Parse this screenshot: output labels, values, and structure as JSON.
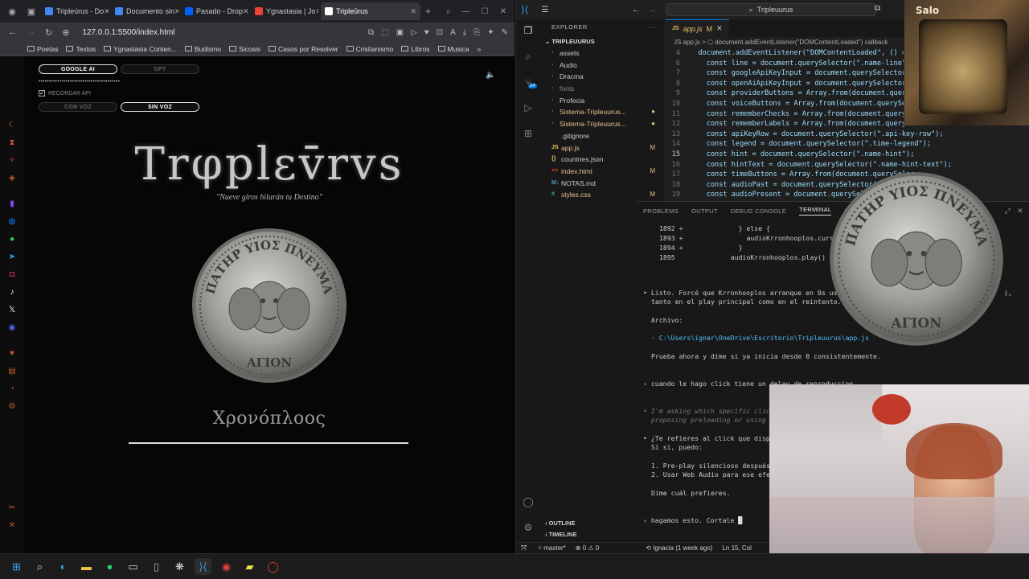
{
  "browser": {
    "tabs": [
      {
        "label": "Tripleúrus - Do",
        "color": "#4285f4",
        "active": false
      },
      {
        "label": "Documento sin",
        "color": "#4285f4",
        "active": false
      },
      {
        "label": "Pasado - Drop",
        "color": "#0061fe",
        "active": false
      },
      {
        "label": "Ygnastasia | Jo",
        "color": "#ea4335",
        "active": false
      },
      {
        "label": "Tripleūrus",
        "color": "#ffffff",
        "active": true
      }
    ],
    "url": "127.0.0.1:5500/index.html",
    "bookmarks": [
      "Poetas",
      "Textos",
      "Ygnastasia Conten...",
      "Budismo",
      "Sicosis",
      "Casos por Resolver",
      "Cristianismo",
      "Libros",
      "Musica"
    ]
  },
  "app": {
    "provider_google": "GOOGLE AI",
    "provider_gpt": "GPT",
    "api_key_masked": "•••••••••••••••••••••••••••••••••••••••",
    "remember_label": "RECORDAR API",
    "remember_check": "✓",
    "voice_on": "CON VOZ",
    "voice_off": "SIN VOZ",
    "title": "Trφplεv̄rvs",
    "subtitle": "\"Nueve giros hilarán tu Destino\"",
    "coin_top_text": "ΠΑΤΗΡ ΥΙΟΣ ΠΝΕΥΜΑ",
    "coin_bottom_text": "ΑΓΙΟΝ",
    "chrono": "Χρονόπλοος"
  },
  "vscode": {
    "search": "Tripleuurus",
    "explorer_title": "EXPLORER",
    "root": "TRIPLEUURUS",
    "tree": [
      {
        "name": "assets",
        "type": "folder",
        "color": "#cccccc",
        "badge": ""
      },
      {
        "name": "Audio",
        "type": "folder",
        "color": "#cccccc",
        "badge": ""
      },
      {
        "name": "Dracma",
        "type": "folder",
        "color": "#cccccc",
        "badge": ""
      },
      {
        "name": "fonts",
        "type": "folder",
        "color": "#8b8b8b",
        "badge": ""
      },
      {
        "name": "Profecia",
        "type": "folder",
        "color": "#cccccc",
        "badge": ""
      },
      {
        "name": "Sistema-Tripleuurus...",
        "type": "folder",
        "color": "#e2c08d",
        "badge": "●"
      },
      {
        "name": "Sistema-Tripleuurus...",
        "type": "folder",
        "color": "#e2c08d",
        "badge": "●"
      },
      {
        "name": ".gitignore",
        "type": "file",
        "color": "#cccccc",
        "badge": ""
      },
      {
        "name": "app.js",
        "type": "js",
        "color": "#e2c08d",
        "badge": "M"
      },
      {
        "name": "countries.json",
        "type": "json",
        "color": "#cccccc",
        "badge": ""
      },
      {
        "name": "index.html",
        "type": "html",
        "color": "#e2c08d",
        "badge": "M"
      },
      {
        "name": "NOTAS.md",
        "type": "md",
        "color": "#cccccc",
        "badge": ""
      },
      {
        "name": "styles.css",
        "type": "css",
        "color": "#e2c08d",
        "badge": "M"
      }
    ],
    "outline": "OUTLINE",
    "timeline": "TIMELINE",
    "editor_tab": "app.js",
    "editor_tab_badge": "M",
    "breadcrumb": "JS app.js > ⬡ document.addEventListener(\"DOMContentLoaded\") callback",
    "code": [
      {
        "ln": "4",
        "text": "  document.addEventListener(\"DOMContentLoaded\", () => {"
      },
      {
        "ln": "6",
        "text": "    const line = document.querySelector(\".name-line\");"
      },
      {
        "ln": "7",
        "text": "    const googleApiKeyInput = document.querySelector(\"#api"
      },
      {
        "ln": "8",
        "text": "    const openAiApiKeyInput = document.querySelector(\"#api"
      },
      {
        "ln": "9",
        "text": "    const providerButtons = Array.from(document.querySelec"
      },
      {
        "ln": "10",
        "text": "    const voiceButtons = Array.from(document.querySelector"
      },
      {
        "ln": "11",
        "text": "    const rememberChecks = Array.from(document.querySelect"
      },
      {
        "ln": "12",
        "text": "    const rememberLabels = Array.from(document.querySelect"
      },
      {
        "ln": "13",
        "text": "    const apiKeyRow = document.querySelector(\".api-key-row\");"
      },
      {
        "ln": "14",
        "text": "    const legend = document.querySelector(\".time-legend\");"
      },
      {
        "ln": "15",
        "text": "    const hint = document.querySelector(\".name-hint\");"
      },
      {
        "ln": "16",
        "text": "    const hintText = document.querySelector(\".name-hint-text\");"
      },
      {
        "ln": "17",
        "text": "    const timeButtons = Array.from(document.querySelec"
      },
      {
        "ln": "18",
        "text": "    const audioPast = document.querySelector(\"#au"
      },
      {
        "ln": "19",
        "text": "    const audioPresent = document.querySelect"
      }
    ],
    "panel_tabs": [
      "PROBLEMS",
      "OUTPUT",
      "DEBUG CONSOLE",
      "TERMINAL",
      "PORTS"
    ],
    "terminal": {
      "diff1": "1892 +              } else {",
      "diff2": "1893 +                audioKrronhooplos.currentTim",
      "diff3": "1894 +              }",
      "diff4": "1895              audioKrronhooplos.play()",
      "msg1": "• Listo. Forcé que Krronhooplos arranque en 0s usando",
      "msg1b": "tanto en el play principal como en el reintento.",
      "msg1c": "),",
      "archivo": "Archivo:",
      "path": "- C:\\Users\\ignar\\OneDrive\\Escritorio\\Tripleuurus\\app.js",
      "prueba": "Prueba ahora y dime si ya inicia desde 0 consistentemente.",
      "user1": "› cuando le hago click tiene un delay de reproduccion",
      "think1": "• I'm asking which specific click",
      "think2": "  proposing preloading or using We",
      "q1": "• ¿Te refieres al click que dispar",
      "q2": "  Sí si, puedo:",
      "opt1": "1. Pre-play silencioso después d",
      "opt2": "2. Usar Web Audio para ese efect",
      "dime": "Dime cuál prefieres.",
      "prompt": "› hagamos esto. Cortale "
    },
    "status_branch": "master*",
    "status_errors": "⊗ 0 ⚠ 0",
    "status_blame": "Ignacia (1 week ago)",
    "status_pos": "Ln 15, Col"
  },
  "overlay": {
    "stamp": "Salo"
  },
  "colors": {
    "accent": "#0078d4",
    "modified": "#e2c08d",
    "diff_add": "#3fb950"
  }
}
